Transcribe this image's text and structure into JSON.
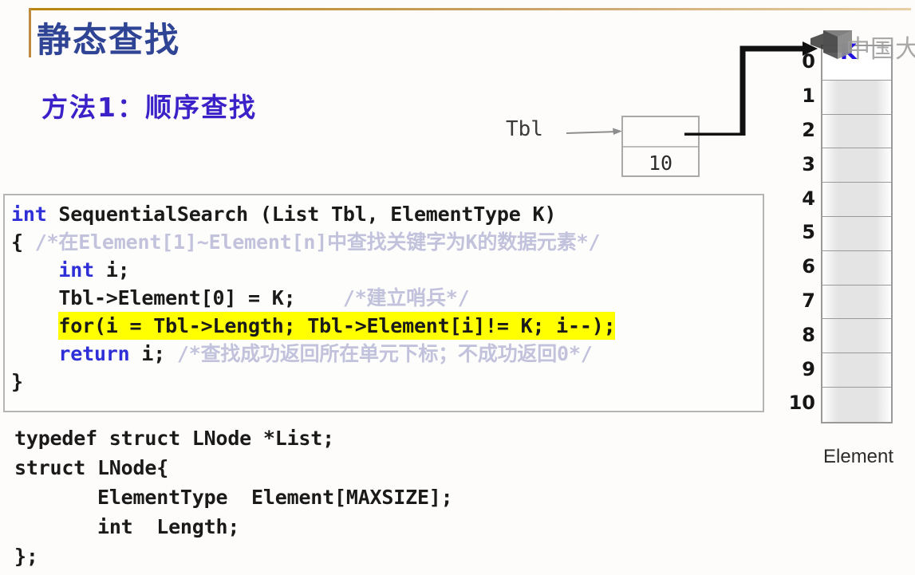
{
  "slide": {
    "title": "静态查找",
    "subtitle": "方法1：顺序查找"
  },
  "diagram": {
    "pointer_label": "Tbl",
    "tbl_box": {
      "pointer_cell": "",
      "length_value": "10"
    },
    "element_table": {
      "caption": "Element",
      "indices": [
        "0",
        "1",
        "2",
        "3",
        "4",
        "5",
        "6",
        "7",
        "8",
        "9",
        "10"
      ],
      "cell_values": [
        "K",
        "",
        "",
        "",
        "",
        "",
        "",
        "",
        "",
        "",
        ""
      ]
    },
    "watermark_text": "中国大"
  },
  "code": {
    "signature_kw": "int",
    "signature_rest": " SequentialSearch (List Tbl, ElementType K)",
    "line_brace_open": "{ ",
    "comment_header": "/*在Element[1]~Element[n]中查找关键字为K的数据元素*/",
    "decl_kw": "int",
    "decl_rest": " i;",
    "sentinel_code": "Tbl->Element[0] = K;",
    "sentinel_comment": "/*建立哨兵*/",
    "for_loop": "for(i = Tbl->Length; Tbl->Element[i]!= K; i--);",
    "return_kw": "return",
    "return_rest": " i; ",
    "return_comment": "/*查找成功返回所在单元下标；不成功返回0*/",
    "line_brace_close": "}"
  },
  "typedef": {
    "line1": "typedef struct LNode *List;",
    "line2": "struct LNode{",
    "line3": "ElementType  Element[MAXSIZE];",
    "line4": "int  Length;",
    "line5": "};"
  },
  "colors": {
    "title_blue": "#2f4495",
    "subtitle_purple": "#3b21c8",
    "keyword_blue": "#2f2fd8",
    "comment_gray": "#c2c2dd",
    "highlight_yellow": "#ffff00",
    "rule_gold": "#c08a3e",
    "k_blue": "#2412e0"
  }
}
